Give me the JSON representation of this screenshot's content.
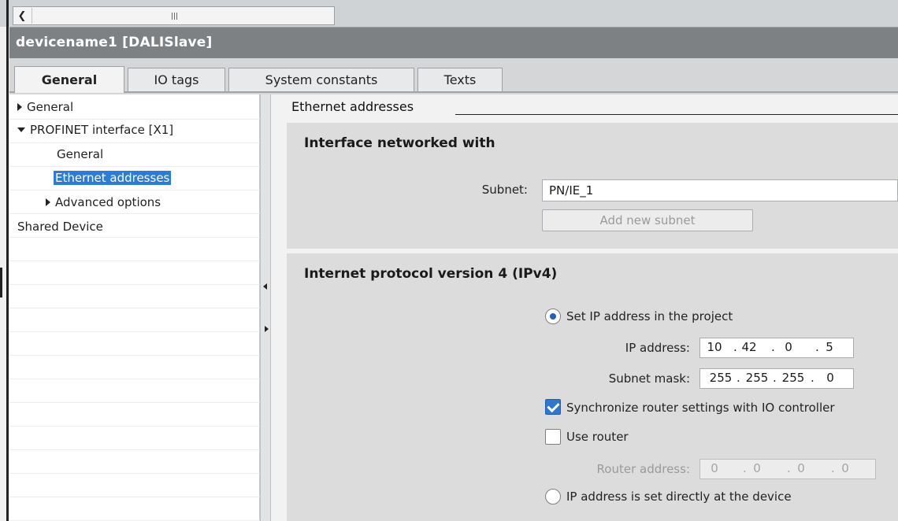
{
  "window": {
    "title": "devicename1 [DALISlave]"
  },
  "scroll": {
    "grip_label": "III"
  },
  "tabs": [
    {
      "label": "General",
      "active": true
    },
    {
      "label": "IO tags",
      "active": false
    },
    {
      "label": "System constants",
      "active": false
    },
    {
      "label": "Texts",
      "active": false
    }
  ],
  "tree": {
    "items": [
      {
        "label": "General",
        "expander": "collapsed"
      },
      {
        "label": "PROFINET interface [X1]",
        "expander": "expanded"
      },
      {
        "label": "General",
        "expander": "none"
      },
      {
        "label": "Ethernet addresses",
        "expander": "none",
        "selected": true
      },
      {
        "label": "Advanced options",
        "expander": "collapsed"
      },
      {
        "label": "Shared Device",
        "expander": "none"
      }
    ]
  },
  "content": {
    "section_heading": "Ethernet addresses",
    "interface_panel": {
      "title": "Interface networked with",
      "subnet_label": "Subnet:",
      "subnet_value": "PN/IE_1",
      "add_subnet_button": "Add new subnet"
    },
    "ipv4_panel": {
      "title": "Internet protocol version 4 (IPv4)",
      "set_ip_option": "Set IP address in the project",
      "set_ip_selected": true,
      "ip_label": "IP address:",
      "ip_octets": [
        "10",
        "42",
        "0",
        "5"
      ],
      "mask_label": "Subnet mask:",
      "mask_octets": [
        "255",
        "255",
        "255",
        "0"
      ],
      "sync_router_label": "Synchronize router settings with IO controller",
      "sync_router_checked": true,
      "use_router_label": "Use router",
      "use_router_checked": false,
      "router_label": "Router address:",
      "router_octets": [
        "0",
        "0",
        "0",
        "0"
      ],
      "device_ip_option": "IP address is set directly at the device",
      "device_ip_selected": false
    }
  },
  "colors": {
    "title_bar": "#7d8184",
    "selection": "#2b7cd8",
    "panel_bg": "#dcdcdc"
  }
}
